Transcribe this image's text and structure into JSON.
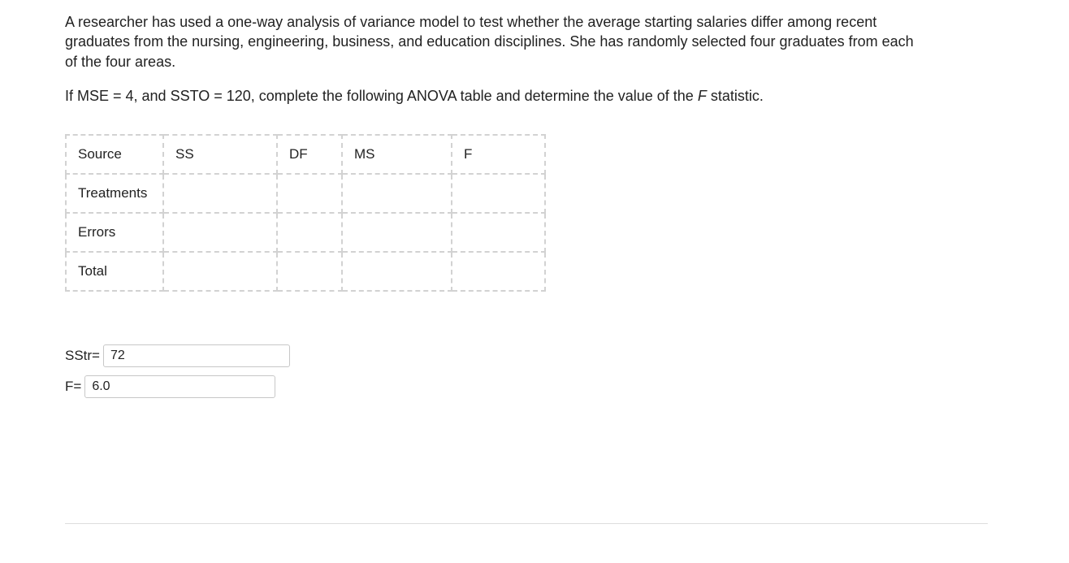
{
  "problem": {
    "p1": "A researcher has used a one-way analysis of variance model to test whether the average starting salaries differ among recent graduates from the nursing, engineering, business, and education disciplines. She has randomly selected four graduates from each of the four areas.",
    "p2_prefix": "If MSE = 4, and SSTO = 120, complete the following ANOVA table and determine the value of the ",
    "p2_italic": "F",
    "p2_suffix": " statistic."
  },
  "table": {
    "headers": {
      "source": "Source",
      "ss": "SS",
      "df": "DF",
      "ms": "MS",
      "f": "F"
    },
    "rows": {
      "treatments": {
        "label": "Treatments",
        "ss": "",
        "df": "",
        "ms": "",
        "f": ""
      },
      "errors": {
        "label": "Errors",
        "ss": "",
        "df": "",
        "ms": "",
        "f": ""
      },
      "total": {
        "label": "Total",
        "ss": "",
        "df": "",
        "ms": "",
        "f": ""
      }
    }
  },
  "answers": {
    "sstr_label": "SStr=",
    "sstr_value": "72",
    "f_label": "F=",
    "f_value": "6.0"
  }
}
